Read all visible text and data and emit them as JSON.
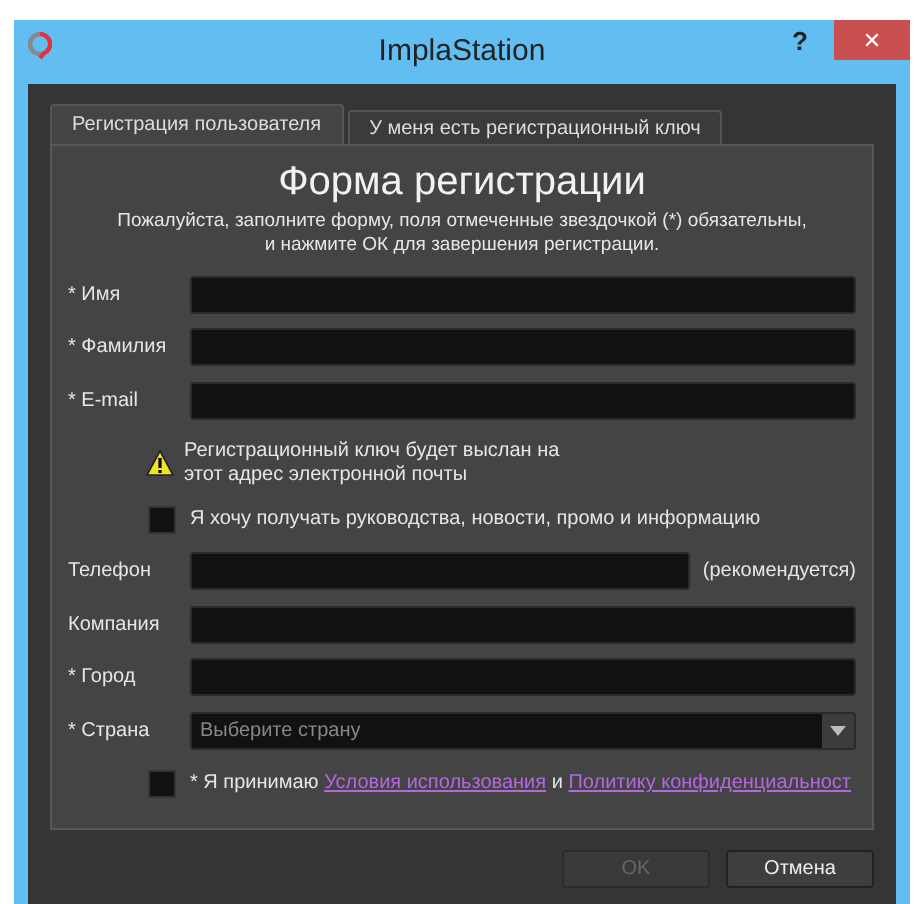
{
  "window": {
    "title": "ImplaStation",
    "help": "?",
    "close": "✕"
  },
  "tabs": [
    {
      "label": "Регистрация пользователя",
      "selected": true
    },
    {
      "label": "У меня есть регистрационный ключ",
      "selected": false
    }
  ],
  "form": {
    "title": "Форма регистрации",
    "instructions": "Пожалуйста, заполните форму, поля отмеченные звездочкой (*) обязательны,\nи нажмите ОК для завершения регистрации."
  },
  "fields_top": [
    {
      "label": "* Имя",
      "kind": "text"
    },
    {
      "label": "* Фамилия",
      "kind": "text"
    },
    {
      "label": "* E-mail",
      "kind": "text"
    }
  ],
  "notice": {
    "text": "Регистрационный ключ будет выслан на\nэтот адрес электронной почты"
  },
  "newsletter": {
    "label": "Я хочу получать руководства, новости, промо и информацию",
    "checked": false
  },
  "fields_bottom": [
    {
      "label": "Телефон",
      "kind": "text",
      "note": "(рекомендуется)"
    },
    {
      "label": "Компания",
      "kind": "text"
    },
    {
      "label": "* Город",
      "kind": "text"
    },
    {
      "label": "* Страна",
      "kind": "select",
      "placeholder": "Выберите страну"
    }
  ],
  "agreement": {
    "checked": false,
    "parts": [
      {
        "kind": "text",
        "text": "* Я принимаю"
      },
      {
        "kind": "link",
        "text": "Условия использования"
      },
      {
        "kind": "text",
        "text": "и"
      },
      {
        "kind": "link",
        "text": "Политику конфиденциальност"
      }
    ]
  },
  "buttons": [
    {
      "label": "OK",
      "disabled": true
    },
    {
      "label": "Отмена",
      "disabled": false
    }
  ]
}
